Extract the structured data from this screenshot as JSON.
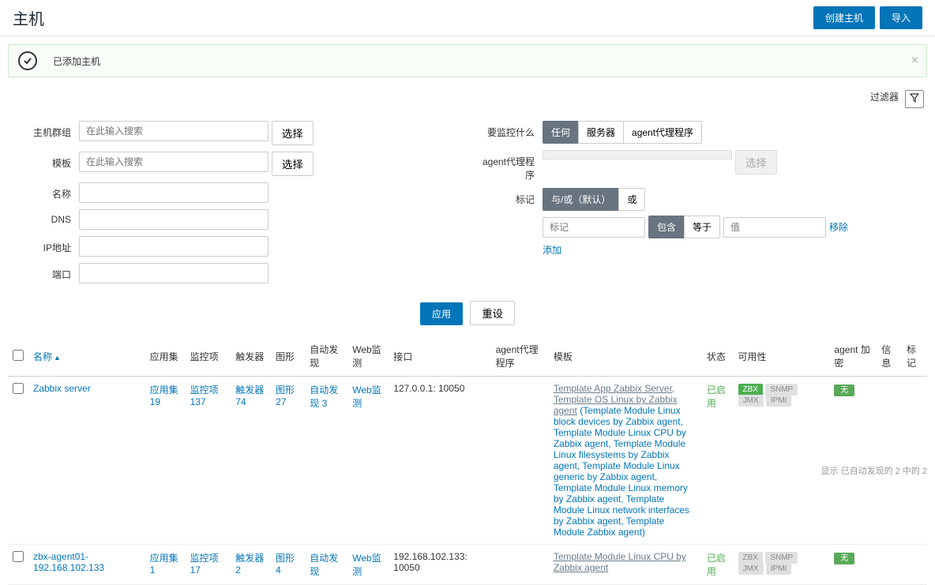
{
  "page": {
    "title": "主机",
    "create_btn": "创建主机",
    "import_btn": "导入"
  },
  "alert": {
    "message": "已添加主机"
  },
  "filter": {
    "label": "过滤器",
    "fields": {
      "host_group": "主机群组",
      "template": "模板",
      "name": "名称",
      "dns": "DNS",
      "ip": "IP地址",
      "port": "端口",
      "monitor_what": "要监控什么",
      "agent_proxy": "agent代理程序",
      "tags": "标记"
    },
    "search_placeholder": "在此输入搜索",
    "select_btn": "选择",
    "monitor_opts": [
      "任何",
      "服务器",
      "agent代理程序"
    ],
    "tag_opts": [
      "与/或（默认）",
      "或"
    ],
    "tag_placeholder": "标记",
    "contains_opts": [
      "包含",
      "等于"
    ],
    "value_placeholder": "值",
    "remove": "移除",
    "add": "添加",
    "apply": "应用",
    "reset": "重设"
  },
  "table": {
    "headers": {
      "name": "名称",
      "apps": "应用集",
      "items": "监控项",
      "triggers": "触发器",
      "graphs": "图形",
      "discovery": "自动发现",
      "web": "Web监测",
      "interface": "接口",
      "proxy": "agent代理程序",
      "template": "模板",
      "status": "状态",
      "availability": "可用性",
      "encryption": "agent 加密",
      "info": "信息",
      "tags": "标记"
    },
    "rows": [
      {
        "name": "Zabbix server",
        "apps": "应用集 19",
        "items": "监控项 137",
        "triggers": "触发器 74",
        "graphs": "图形 27",
        "discovery": "自动发现 3",
        "web": "Web监测",
        "interface": "127.0.0.1: 10050",
        "templates_plain": "Template App Zabbix Server, Template OS Linux by Zabbix agent",
        "templates_links": " (Template Module Linux block devices by Zabbix agent, Template Module Linux CPU by Zabbix agent, Template Module Linux filesystems by Zabbix agent, Template Module Linux generic by Zabbix agent, Template Module Linux memory by Zabbix agent, Template Module Linux network interfaces by Zabbix agent, Template Module Zabbix agent)",
        "status": "已启用",
        "avail": [
          "ZBX",
          "SNMP",
          "JMX",
          "IPMI"
        ],
        "encryption": "无"
      },
      {
        "name": "zbx-agent01-192.168.102.133",
        "apps": "应用集 1",
        "items": "监控项 17",
        "triggers": "触发器 2",
        "graphs": "图形 4",
        "discovery": "自动发现",
        "web": "Web监测",
        "interface": "192.168.102.133: 10050",
        "templates_plain": "",
        "templates_links": "Template Module Linux CPU by Zabbix agent",
        "status": "已启用",
        "avail": [
          "ZBX",
          "SNMP",
          "JMX",
          "IPMI"
        ],
        "encryption": "无"
      }
    ]
  },
  "footer": "显示 已自动发现的 2 中的 2"
}
